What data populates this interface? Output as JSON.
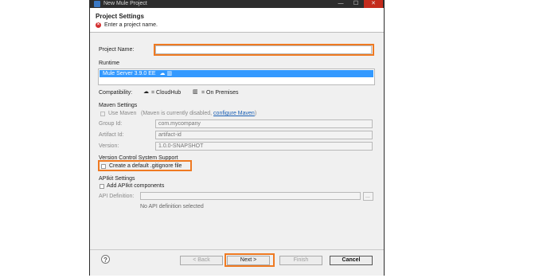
{
  "window": {
    "title": "New Mule Project",
    "minimize": "—",
    "maximize": "☐",
    "close": "✕"
  },
  "header": {
    "title": "Project Settings",
    "error_message": "Enter a project name.",
    "error_glyph": "×"
  },
  "project_name": {
    "label": "Project Name:",
    "value": ""
  },
  "runtime": {
    "label": "Runtime",
    "selected": "Mule Server 3.9.0 EE"
  },
  "compatibility": {
    "label": "Compatibility:",
    "cloudhub": "= CloudHub",
    "onprem": "= On Premises"
  },
  "maven": {
    "section": "Maven Settings",
    "use_label": "Use Maven",
    "note_prefix": "(Maven is currently disabled,",
    "note_link": "configure Maven",
    "note_suffix": ")",
    "group_label": "Group Id:",
    "group_value": "com.mycompany",
    "artifact_label": "Artifact Id:",
    "artifact_value": "artifact-id",
    "version_label": "Version:",
    "version_value": "1.0.0-SNAPSHOT"
  },
  "vcs": {
    "section": "Version Control System Support",
    "gitignore_label": "Create a default .gitignore file"
  },
  "apikit": {
    "section": "APIkit Settings",
    "add_label": "Add APIkit components",
    "definition_label": "API Definition:",
    "browse_label": "...",
    "none_label": "No API definition selected"
  },
  "buttons": {
    "help": "?",
    "back": "< Back",
    "next": "Next >",
    "finish": "Finish",
    "cancel": "Cancel"
  },
  "colors": {
    "highlight": "#ef7a22",
    "selection": "#3399ff",
    "link": "#1a5fb4"
  }
}
